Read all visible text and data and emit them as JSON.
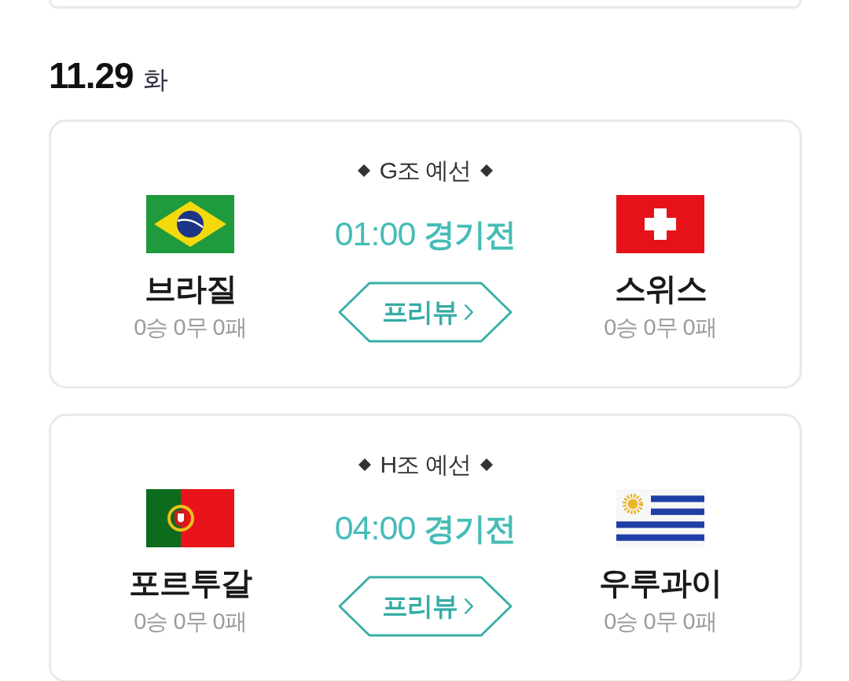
{
  "sections": [
    {
      "date": "11.29",
      "weekday": "화",
      "matches": [
        {
          "group": "G조 예선",
          "time": "01:00",
          "status": "경기전",
          "preview": "프리뷰",
          "teams": [
            {
              "kind": "brazil",
              "name": "브라질",
              "record": "0승 0무 0패"
            },
            {
              "kind": "switzerland",
              "name": "스위스",
              "record": "0승 0무 0패"
            }
          ]
        },
        {
          "group": "H조 예선",
          "time": "04:00",
          "status": "경기전",
          "preview": "프리뷰",
          "teams": [
            {
              "kind": "portugal",
              "name": "포르투갈",
              "record": "0승 0무 0패"
            },
            {
              "kind": "uruguay",
              "name": "우루과이",
              "record": "0승 0무 0패"
            }
          ]
        }
      ]
    }
  ]
}
